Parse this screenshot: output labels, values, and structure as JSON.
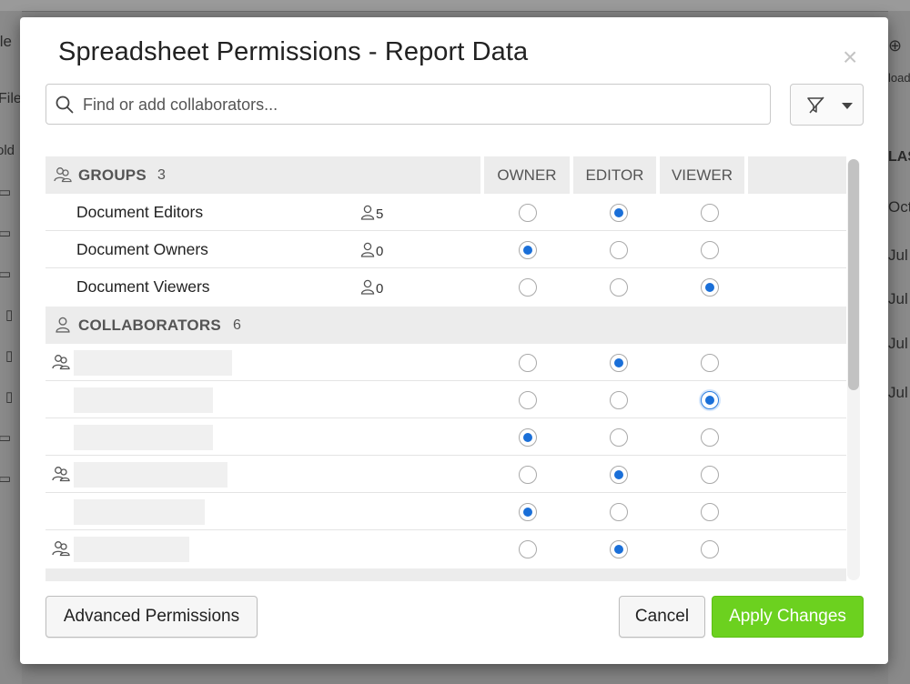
{
  "background": {
    "left_texts": [
      "ile",
      "File",
      "old"
    ],
    "right_texts": [
      "load",
      "LAS",
      "Oct",
      "Jul",
      "Jul",
      "Jul",
      "Jul"
    ]
  },
  "dialog": {
    "title": "Spreadsheet Permissions - Report Data",
    "close_glyph": "×",
    "search": {
      "placeholder": "Find or add collaborators...",
      "value": ""
    },
    "columns": {
      "owner": "OWNER",
      "editor": "EDITOR",
      "viewer": "VIEWER"
    },
    "groups_section": {
      "label": "GROUPS",
      "count": "3"
    },
    "groups": [
      {
        "name": "Document Editors",
        "members": "5",
        "role": "editor"
      },
      {
        "name": "Document Owners",
        "members": "0",
        "role": "owner"
      },
      {
        "name": "Document Viewers",
        "members": "0",
        "role": "viewer"
      }
    ],
    "collaborators_section": {
      "label": "COLLABORATORS",
      "count": "6"
    },
    "collaborators": [
      {
        "is_group": true,
        "role": "editor"
      },
      {
        "is_group": false,
        "role": "viewer",
        "focused": true
      },
      {
        "is_group": false,
        "role": "owner"
      },
      {
        "is_group": true,
        "role": "editor"
      },
      {
        "is_group": false,
        "role": "owner"
      },
      {
        "is_group": true,
        "role": "editor"
      }
    ],
    "buttons": {
      "advanced": "Advanced Permissions",
      "cancel": "Cancel",
      "apply": "Apply Changes"
    },
    "colors": {
      "accent": "#1a6fd8",
      "apply": "#6cd11f"
    },
    "icons": [
      "search-icon",
      "filter-icon",
      "groups-icon",
      "person-icon",
      "close-icon"
    ]
  }
}
